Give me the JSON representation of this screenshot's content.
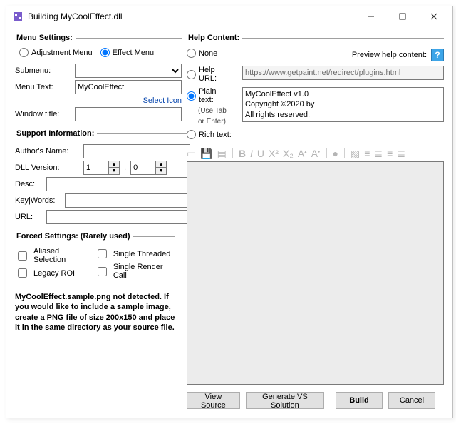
{
  "title": "Building MyCoolEffect.dll",
  "left": {
    "menu_legend": "Menu Settings:",
    "adjustment": "Adjustment Menu",
    "effect": "Effect Menu",
    "submenu": "Submenu:",
    "menu_text_label": "Menu Text:",
    "menu_text_value": "MyCoolEffect",
    "select_icon": "Select Icon",
    "window_title": "Window title:",
    "support_legend": "Support Information:",
    "author": "Author's Name:",
    "dll_version": "DLL Version:",
    "ver_major": "1",
    "ver_minor": "0",
    "desc": "Desc:",
    "keywords": "Key|Words:",
    "url": "URL:",
    "forced_legend": "Forced Settings: (Rarely used)",
    "aliased": "Aliased Selection",
    "single_thread": "Single Threaded",
    "legacy_roi": "Legacy ROI",
    "single_render": "Single Render Call",
    "note": "MyCoolEffect.sample.png not detected.  If you would like to include a sample image, create a PNG file of size 200x150 and place it in the same directory as your source file."
  },
  "right": {
    "help_legend": "Help Content:",
    "none": "None",
    "preview_label": "Preview help content:",
    "help_url": "Help URL:",
    "help_url_value": "https://www.getpaint.net/redirect/plugins.html",
    "plain": "Plain text:",
    "plain_note1": "(Use Tab",
    "plain_note2": "or Enter)",
    "plain_value": "MyCoolEffect v1.0\nCopyright ©2020 by\nAll rights reserved.",
    "rich": "Rich text:"
  },
  "footer": {
    "view_source": "View Source",
    "gen_vs": "Generate VS Solution",
    "build": "Build",
    "cancel": "Cancel"
  }
}
